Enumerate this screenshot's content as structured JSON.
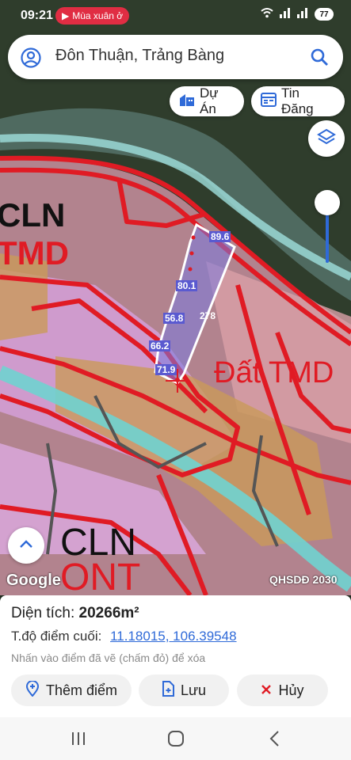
{
  "status_bar": {
    "time": "09:21",
    "notification": "Mùa xuân ở",
    "battery": "77"
  },
  "search": {
    "query": "Đôn Thuận, Trảng Bàng"
  },
  "chips": {
    "du_an": "Dự Án",
    "tin_dang": "Tin Đăng"
  },
  "map": {
    "labels": {
      "cln_top": "CLN",
      "tmd_top": "TMD",
      "dat_tmd": "Đất TMD",
      "cln_bottom": "CLN",
      "ont_bottom": "ONT"
    },
    "edges": [
      "89.6",
      "80.1",
      "278",
      "56.8",
      "66.2",
      "71.9"
    ],
    "google": "Google",
    "plan_tag": "QHSDĐ 2030"
  },
  "panel": {
    "area_label": "Diện tích:",
    "area_value": "20266m²",
    "coord_label": "T.độ điểm cuối:",
    "coord_value": "11.18015, 106.39548",
    "hint": "Nhấn vào điểm đã vẽ (chấm đỏ) để xóa",
    "add_point": "Thêm điểm",
    "save": "Lưu",
    "cancel": "Hủy"
  },
  "colors": {
    "accent": "#2f6ad8",
    "boundary": "#e01b24",
    "polygon": "#6a6ae0"
  }
}
